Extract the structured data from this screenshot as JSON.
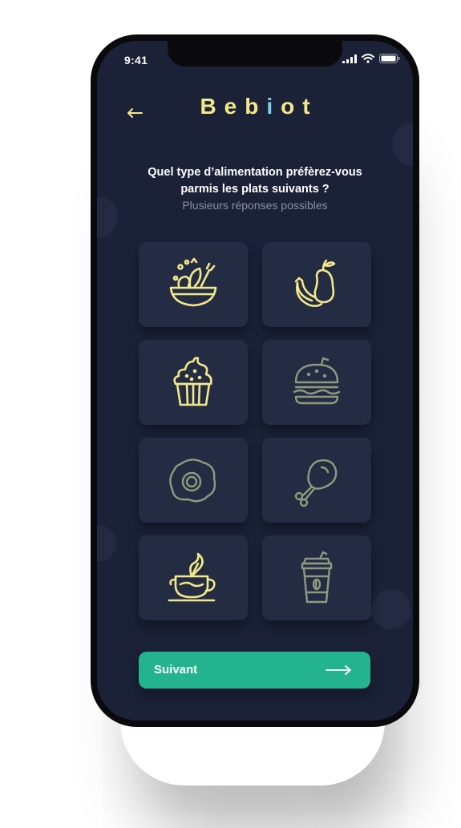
{
  "status_bar": {
    "time": "9:41"
  },
  "header": {
    "logo": {
      "text_before": "Beb",
      "text_accent": "i",
      "text_after": "ot"
    },
    "back_icon": "arrow-left-icon"
  },
  "question": {
    "title_line1": "Quel type d’alimentation préfèrez-vous",
    "title_line2": "parmis les plats suivants ?",
    "subtitle": "Plusieurs réponses possibles"
  },
  "food_options": [
    {
      "icon": "salad-bowl-icon",
      "selected": true
    },
    {
      "icon": "fruit-banana-pear-icon",
      "selected": true
    },
    {
      "icon": "cupcake-icon",
      "selected": true
    },
    {
      "icon": "burger-icon",
      "selected": false
    },
    {
      "icon": "fried-egg-icon",
      "selected": false
    },
    {
      "icon": "chicken-leg-icon",
      "selected": false
    },
    {
      "icon": "tea-cup-icon",
      "selected": true
    },
    {
      "icon": "coffee-cup-icon",
      "selected": false
    }
  ],
  "colors": {
    "background": "#1b2238",
    "card": "#242c44",
    "icon_selected": "#f3e98a",
    "icon_unselected": "#8f9a7c",
    "accent": "#23b48f"
  },
  "footer": {
    "next_label": "Suivant",
    "next_icon": "arrow-right-icon"
  }
}
